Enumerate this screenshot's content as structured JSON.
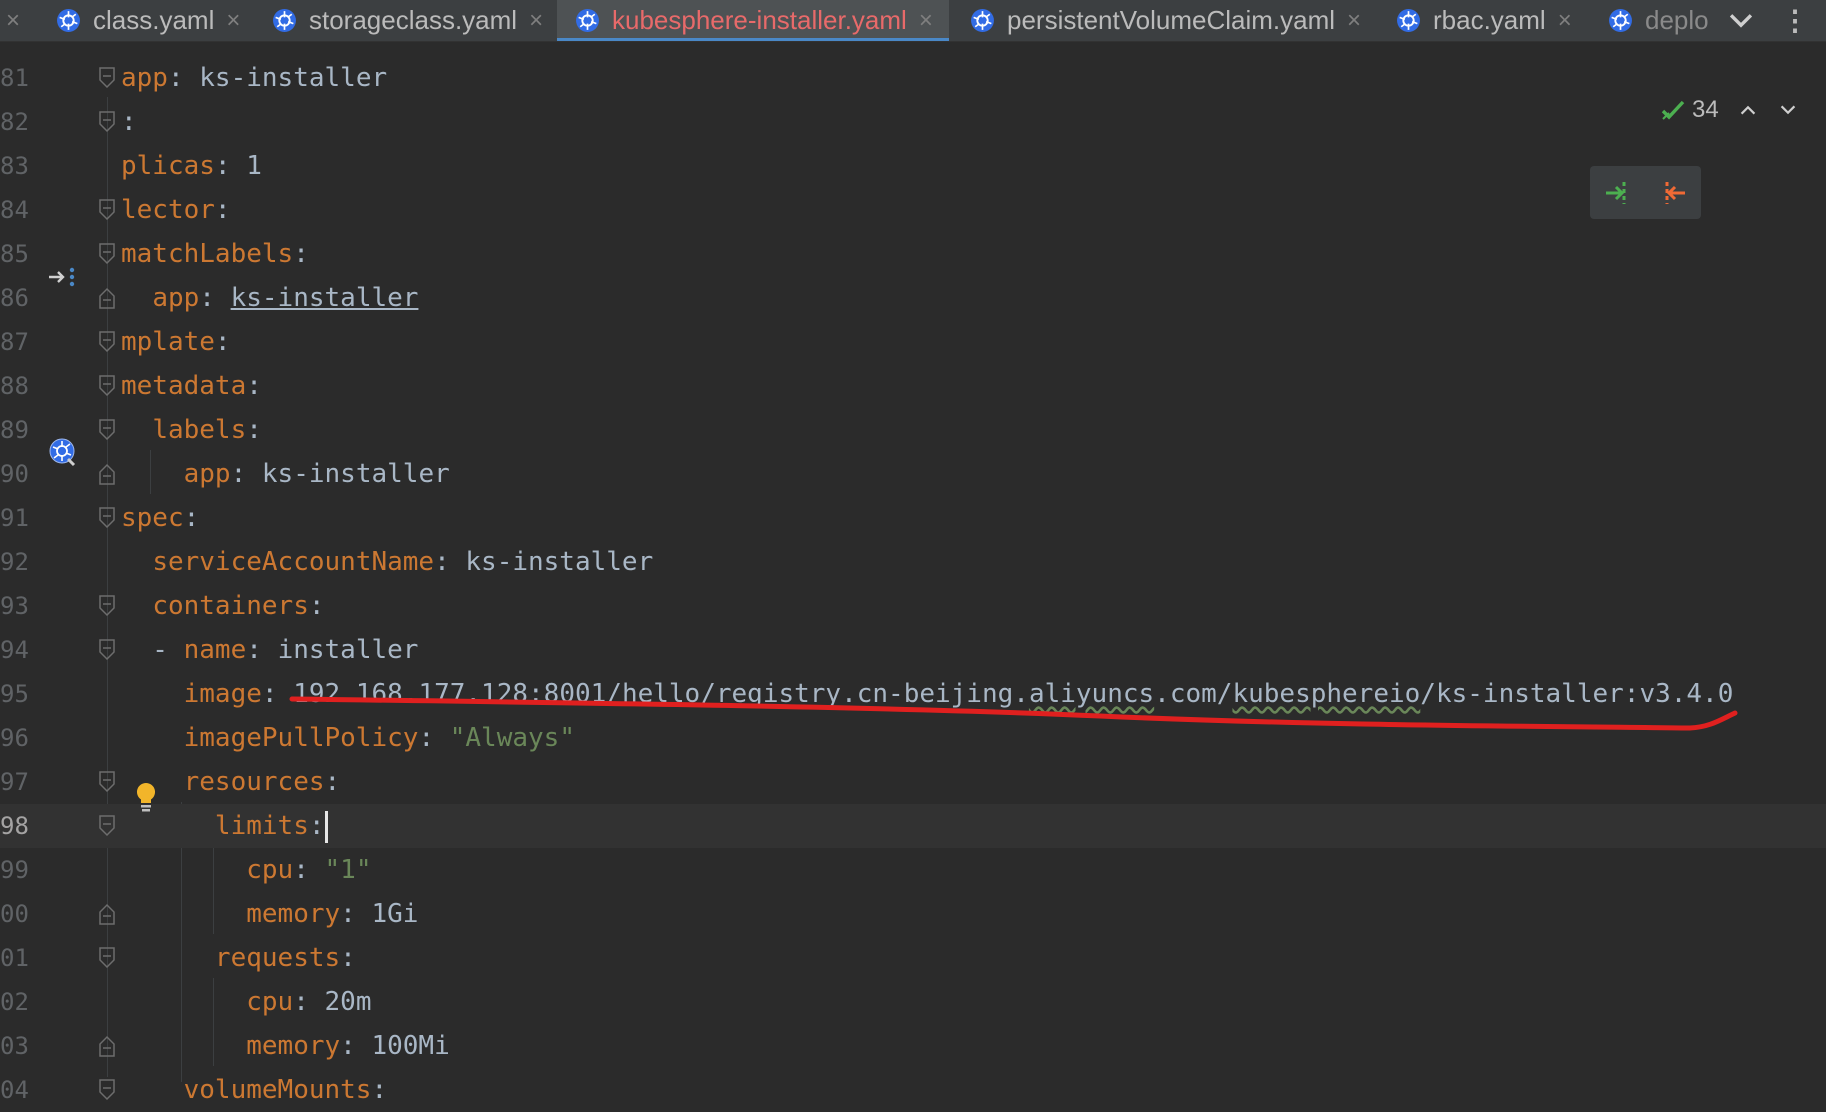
{
  "tabs": [
    {
      "label": "class.yaml",
      "close": "×"
    },
    {
      "label": "storageclass.yaml",
      "close": "×"
    },
    {
      "label": "kubesphere-installer.yaml",
      "close": "×"
    },
    {
      "label": "persistentVolumeClaim.yaml",
      "close": "×"
    },
    {
      "label": "rbac.yaml",
      "close": "×"
    },
    {
      "label": "deplo",
      "close": ""
    }
  ],
  "active_tab": "kubesphere-installer.yaml",
  "first_close": "×",
  "tab_more_label": "⋮",
  "inspections": {
    "count": "34"
  },
  "code_lines": [
    {
      "num": "81",
      "indent": "",
      "key": "app",
      "sep": ": ",
      "value": "ks-installer"
    },
    {
      "num": "82",
      "indent": "",
      "key": "",
      "sep": ":",
      "value": ""
    },
    {
      "num": "83",
      "indent": "",
      "key": "plicas",
      "sep": ": ",
      "value": "1"
    },
    {
      "num": "84",
      "indent": "",
      "key": "lector",
      "sep": ":",
      "value": ""
    },
    {
      "num": "85",
      "indent": "",
      "key": "matchLabels",
      "sep": ":",
      "value": ""
    },
    {
      "num": "86",
      "indent": "  ",
      "key": "app",
      "sep": ": ",
      "value": "ks-installer"
    },
    {
      "num": "87",
      "indent": "",
      "key": "mplate",
      "sep": ":",
      "value": ""
    },
    {
      "num": "88",
      "indent": "",
      "key": "metadata",
      "sep": ":",
      "value": ""
    },
    {
      "num": "89",
      "indent": "  ",
      "key": "labels",
      "sep": ":",
      "value": ""
    },
    {
      "num": "90",
      "indent": "    ",
      "key": "app",
      "sep": ": ",
      "value": "ks-installer"
    },
    {
      "num": "91",
      "indent": "",
      "key": "spec",
      "sep": ":",
      "value": ""
    },
    {
      "num": "92",
      "indent": "  ",
      "key": "serviceAccountName",
      "sep": ": ",
      "value": "ks-installer"
    },
    {
      "num": "93",
      "indent": "  ",
      "key": "containers",
      "sep": ":",
      "value": ""
    },
    {
      "num": "94",
      "indent": "  - ",
      "key": "name",
      "sep": ": ",
      "value": "installer"
    },
    {
      "num": "95",
      "indent": "    ",
      "key": "image",
      "sep": ": ",
      "value": "192.168.177.128:8001/hello/registry.cn-beijing.aliyuncs.com/kubesphereio/ks-installer:v3.4.0"
    },
    {
      "num": "96",
      "indent": "    ",
      "key": "imagePullPolicy",
      "sep": ": ",
      "value": "\"Always\""
    },
    {
      "num": "97",
      "indent": "    ",
      "key": "resources",
      "sep": ":",
      "value": ""
    },
    {
      "num": "98",
      "indent": "      ",
      "key": "limits",
      "sep": ":",
      "value": ""
    },
    {
      "num": "99",
      "indent": "        ",
      "key": "cpu",
      "sep": ": ",
      "value": "\"1\""
    },
    {
      "num": "00",
      "indent": "        ",
      "key": "memory",
      "sep": ": ",
      "value": "1Gi"
    },
    {
      "num": "01",
      "indent": "      ",
      "key": "requests",
      "sep": ":",
      "value": ""
    },
    {
      "num": "02",
      "indent": "        ",
      "key": "cpu",
      "sep": ": ",
      "value": "20m"
    },
    {
      "num": "03",
      "indent": "        ",
      "key": "memory",
      "sep": ": ",
      "value": "100Mi"
    },
    {
      "num": "04",
      "indent": "    ",
      "key": "volumeMounts",
      "sep": ":",
      "value": ""
    }
  ],
  "current_line": "98",
  "colors": {
    "background": "#2b2b2b",
    "key": "#cc7832",
    "value": "#a9b7c6",
    "string": "#6a8759",
    "active_tab_text": "#e86a6a",
    "annotation": "#e0201f",
    "accent": "#4a88c7"
  },
  "icons": {
    "tab_icon": "kubernetes-icon",
    "gutter_85": "run-arrow-icon",
    "gutter_89": "kubernetes-resource-icon",
    "gutter_97": "lightbulb-icon",
    "diff_widget": [
      "diff-apply-icon",
      "diff-revert-icon"
    ]
  }
}
